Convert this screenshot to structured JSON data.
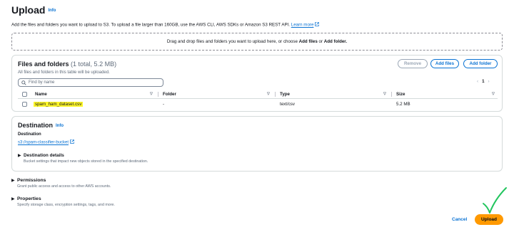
{
  "header": {
    "title": "Upload",
    "info": "Info",
    "description": "Add the files and folders you want to upload to S3. To upload a file larger than 160GB, use the AWS CLI, AWS SDKs or Amazon S3 REST API.",
    "learn_more": "Learn more"
  },
  "dropzone": {
    "text_before": "Drag and drop files and folders you want to upload here, or choose",
    "add_files": "Add files",
    "or": "or",
    "add_folder": "Add folder."
  },
  "files": {
    "title": "Files and folders",
    "count": "(1 total, 5.2 MB)",
    "subtitle": "All files and folders in this table will be uploaded.",
    "buttons": {
      "remove": "Remove",
      "add_files": "Add files",
      "add_folder": "Add folder"
    },
    "search_placeholder": "Find by name",
    "page": "1",
    "columns": {
      "name": "Name",
      "folder": "Folder",
      "type": "Type",
      "size": "Size"
    },
    "rows": [
      {
        "name": "spam_ham_dataset.csv",
        "folder": "-",
        "type": "text/csv",
        "size": "5.2 MB"
      }
    ]
  },
  "destination": {
    "title": "Destination",
    "info": "Info",
    "label": "Destination",
    "bucket": "s3://spam-classifier-bucket",
    "details_title": "Destination details",
    "details_sub": "Bucket settings that impact new objects stored in the specified destination."
  },
  "permissions": {
    "title": "Permissions",
    "sub": "Grant public access and access to other AWS accounts."
  },
  "properties": {
    "title": "Properties",
    "sub": "Specify storage class, encryption settings, tags, and more."
  },
  "footer": {
    "cancel": "Cancel",
    "upload": "Upload"
  },
  "colors": {
    "link": "#0972d3",
    "primary": "#ff9900",
    "highlight": "#fcf529",
    "checkmark": "#22c55e"
  },
  "icons": [
    "external-link-icon",
    "search-icon",
    "chevron-left-icon",
    "chevron-right-icon",
    "sort-icon",
    "caret-right-icon",
    "checkmark-icon"
  ]
}
